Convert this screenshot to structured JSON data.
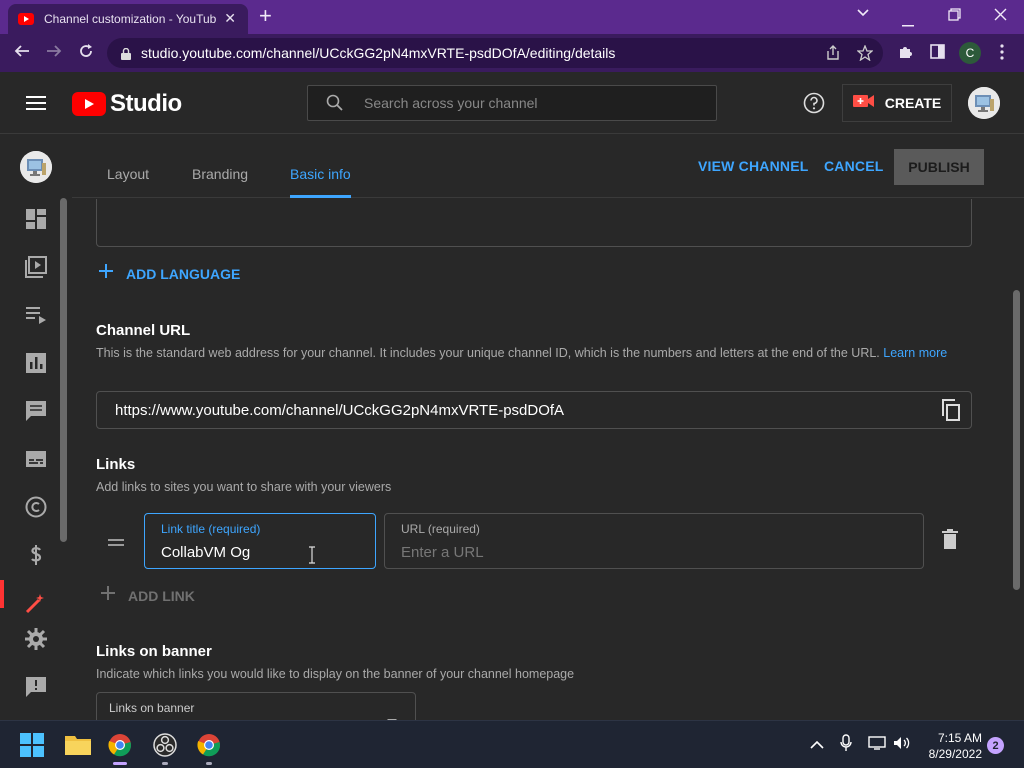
{
  "browser": {
    "tab_title": "Channel customization - YouTube Studio",
    "tab_close": "✕",
    "new_tab": "+",
    "url": "studio.youtube.com/channel/UCckGG2pN4mxVRTE-psdDOfA/editing/details",
    "profile_initial": "C"
  },
  "header": {
    "logo_text": "Studio",
    "search_placeholder": "Search across your channel",
    "create_label": "CREATE"
  },
  "tabs": {
    "items": [
      "Layout",
      "Branding",
      "Basic info"
    ],
    "active": "Basic info",
    "view_channel": "VIEW CHANNEL",
    "cancel": "CANCEL",
    "publish": "PUBLISH"
  },
  "content": {
    "add_language": "ADD LANGUAGE",
    "channel_url": {
      "title": "Channel URL",
      "desc": "This is the standard web address for your channel. It includes your unique channel ID, which is the numbers and letters at the end of the URL.",
      "learn_more": "Learn more",
      "value": "https://www.youtube.com/channel/UCckGG2pN4mxVRTE-psdDOfA"
    },
    "links": {
      "title": "Links",
      "desc": "Add links to sites you want to share with your viewers",
      "link_title_label": "Link title (required)",
      "link_title_value": "CollabVM Og",
      "url_label": "URL (required)",
      "url_placeholder": "Enter a URL",
      "add_link": "ADD LINK"
    },
    "banner": {
      "title": "Links on banner",
      "desc": "Indicate which links you would like to display on the banner of your channel homepage",
      "select_label": "Links on banner"
    }
  },
  "taskbar": {
    "time": "7:15 AM",
    "date": "8/29/2022",
    "notification_count": "2"
  }
}
